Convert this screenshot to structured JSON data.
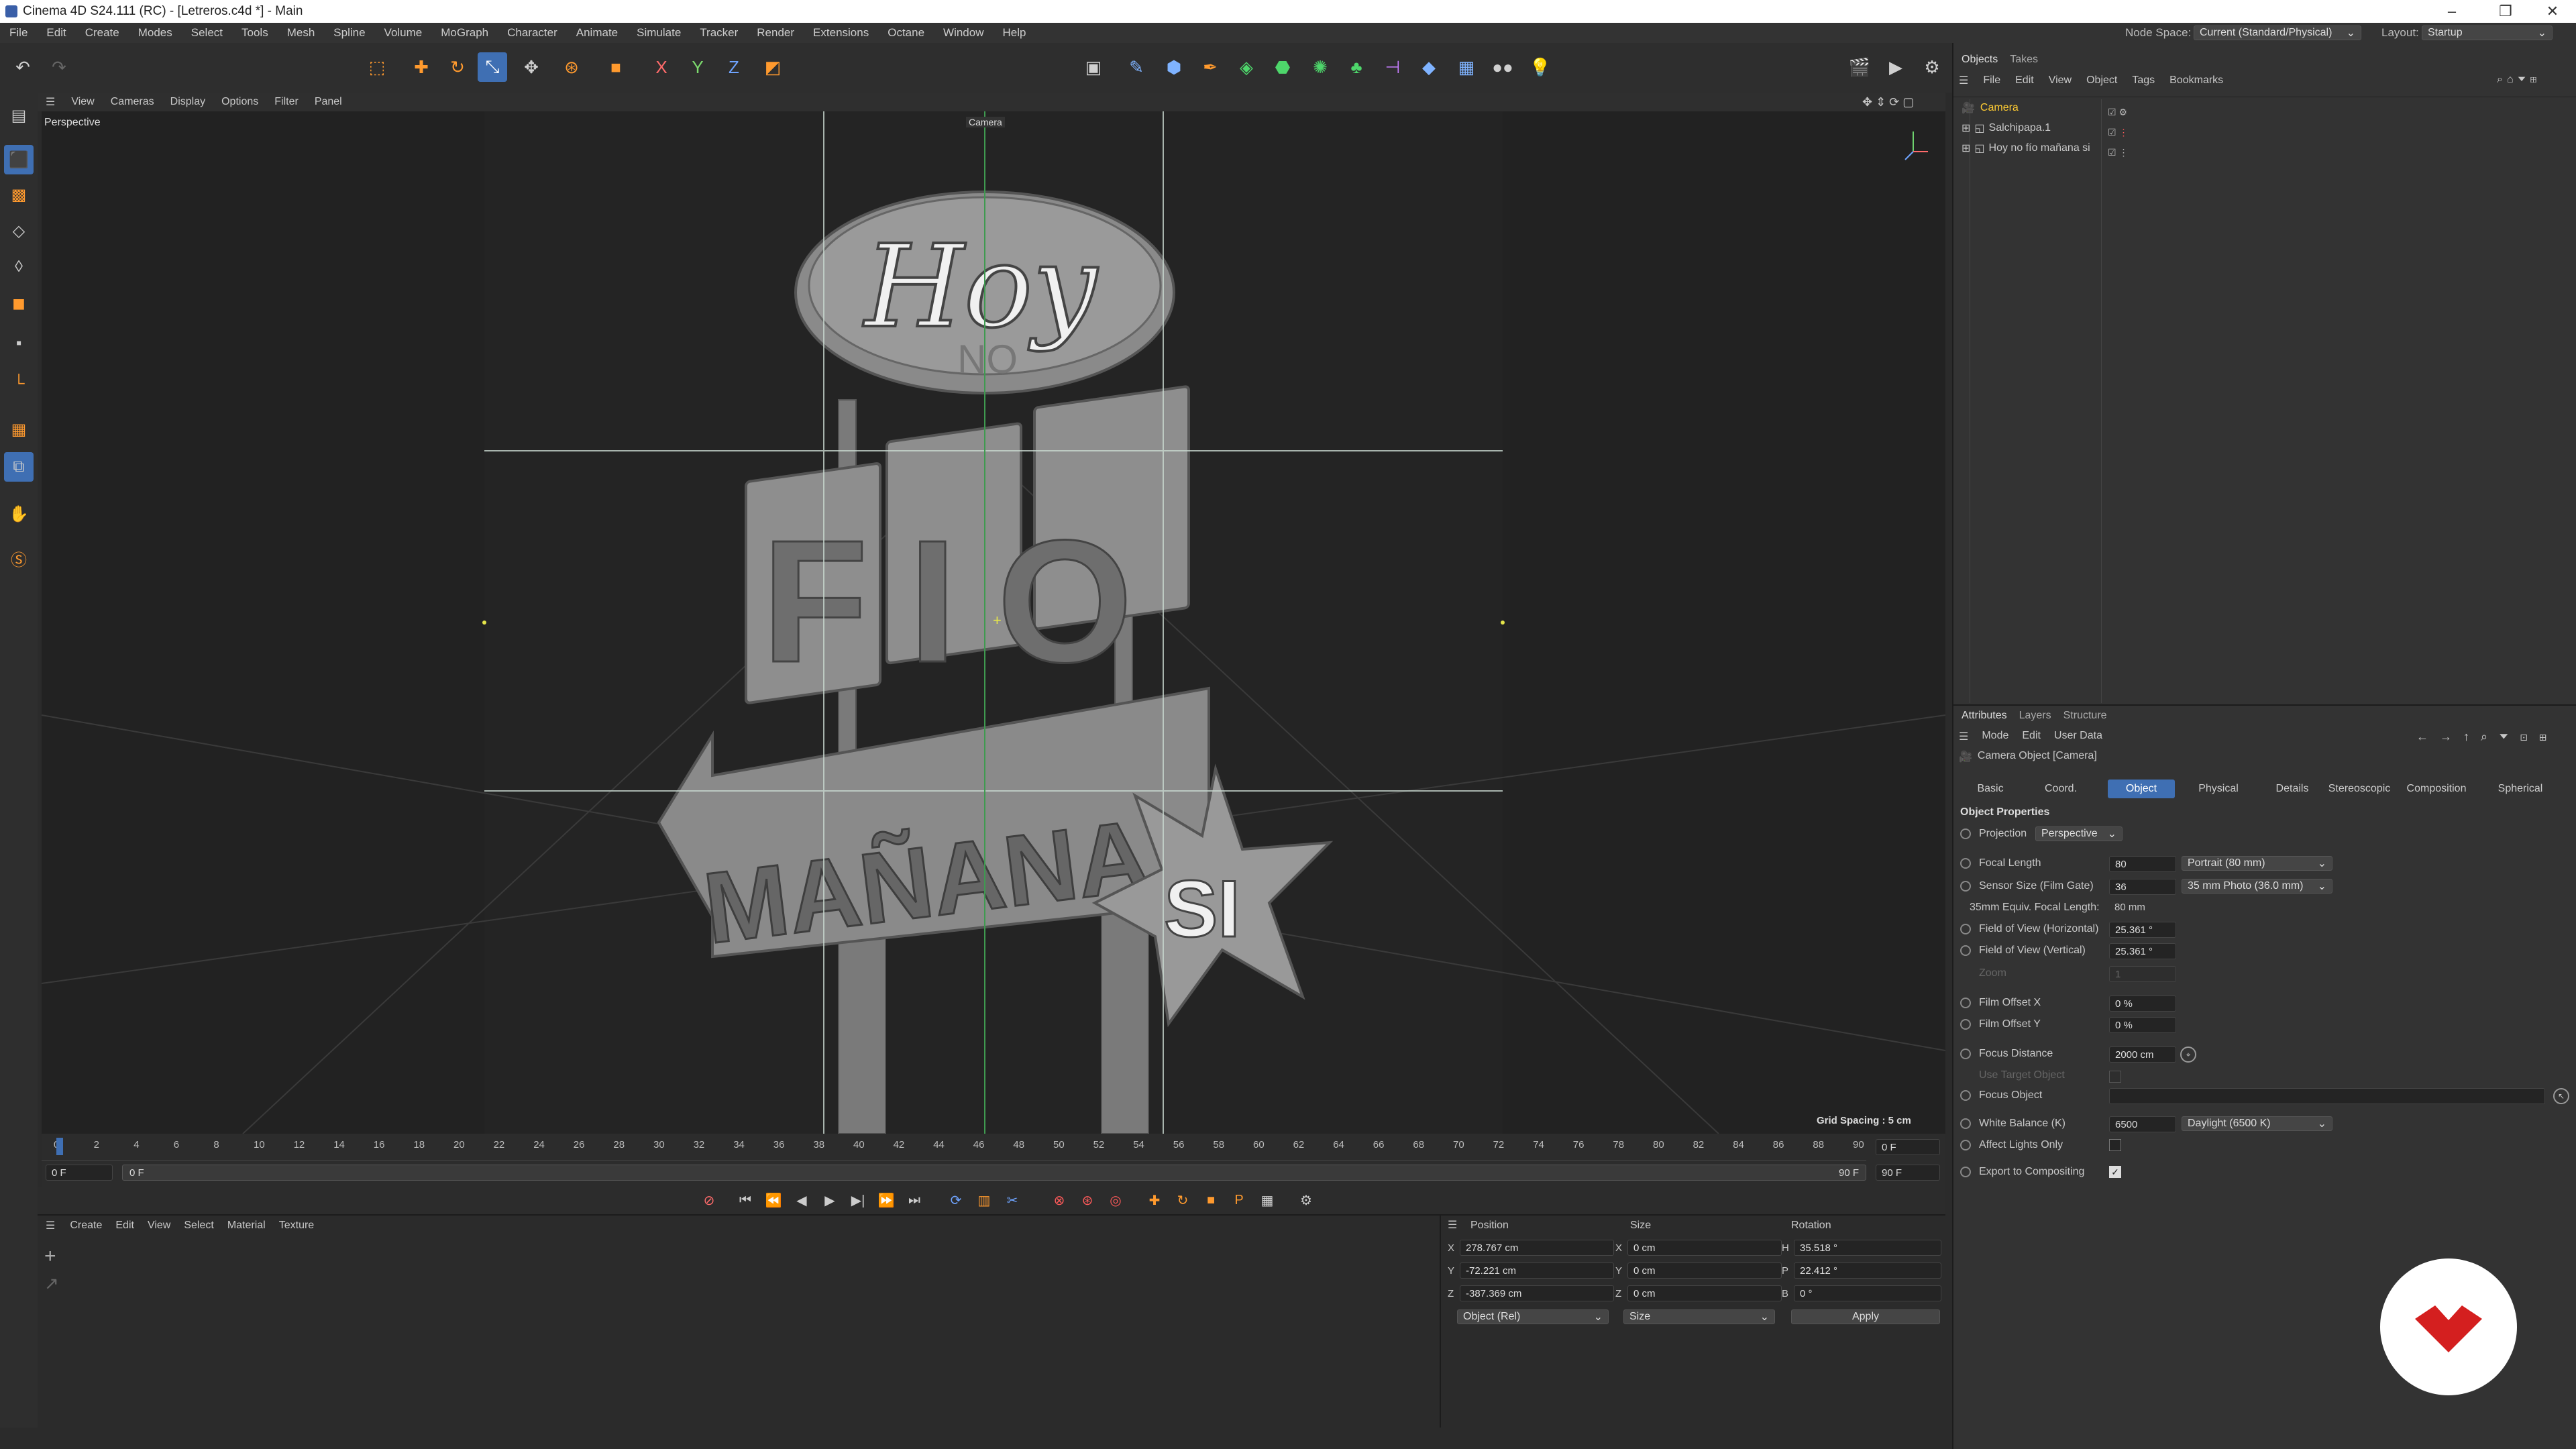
{
  "window": {
    "title": "Cinema 4D S24.111 (RC) - [Letreros.c4d *] - Main"
  },
  "menubar": {
    "items": [
      "File",
      "Edit",
      "Create",
      "Modes",
      "Select",
      "Tools",
      "Mesh",
      "Spline",
      "Volume",
      "MoGraph",
      "Character",
      "Animate",
      "Simulate",
      "Tracker",
      "Render",
      "Extensions",
      "Octane",
      "Window",
      "Help"
    ],
    "node_space_label": "Node Space:",
    "node_space_value": "Current (Standard/Physical)",
    "layout_label": "Layout:",
    "layout_value": "Startup"
  },
  "viewport": {
    "menu": [
      "View",
      "Cameras",
      "Display",
      "Options",
      "Filter",
      "Panel"
    ],
    "name": "Perspective",
    "camera_label": "Camera",
    "grid_spacing": "Grid Spacing : 5 cm",
    "sign": {
      "top": "Hoy",
      "no": "NO",
      "fio": "FIO",
      "arrow": "MAÑANA",
      "star": "SI"
    }
  },
  "timeline": {
    "ticks": [
      "0",
      "2",
      "4",
      "6",
      "8",
      "10",
      "12",
      "14",
      "16",
      "18",
      "20",
      "22",
      "24",
      "26",
      "28",
      "30",
      "32",
      "34",
      "36",
      "38",
      "40",
      "42",
      "44",
      "46",
      "48",
      "50",
      "52",
      "54",
      "56",
      "58",
      "60",
      "62",
      "64",
      "66",
      "68",
      "70",
      "72",
      "74",
      "76",
      "78",
      "80",
      "82",
      "84",
      "86",
      "88",
      "90"
    ],
    "current_frame": "0 F",
    "start": "0 F",
    "range_start": "0 F",
    "range_end": "90 F",
    "end": "90 F"
  },
  "material_manager": {
    "menu": [
      "Create",
      "Edit",
      "View",
      "Select",
      "Material",
      "Texture"
    ]
  },
  "coord_manager": {
    "headers": [
      "Position",
      "Size",
      "Rotation"
    ],
    "rows": [
      {
        "axis": "X",
        "pos": "278.767 cm",
        "size_axis": "X",
        "size": "0 cm",
        "rot_axis": "H",
        "rot": "35.518 °"
      },
      {
        "axis": "Y",
        "pos": "-72.221 cm",
        "size_axis": "Y",
        "size": "0 cm",
        "rot_axis": "P",
        "rot": "22.412 °"
      },
      {
        "axis": "Z",
        "pos": "-387.369 cm",
        "size_axis": "Z",
        "size": "0 cm",
        "rot_axis": "B",
        "rot": "0 °"
      }
    ],
    "mode": "Object (Rel)",
    "size_mode": "Size",
    "apply": "Apply"
  },
  "object_manager": {
    "tabs": [
      "Objects",
      "Takes"
    ],
    "menu": [
      "File",
      "Edit",
      "View",
      "Object",
      "Tags",
      "Bookmarks"
    ],
    "objects": [
      {
        "name": "Camera",
        "color": "#ffcc33"
      },
      {
        "name": "Salchipapa.1",
        "color": "#c8c8c8"
      },
      {
        "name": "Hoy no fío mañana si",
        "color": "#c8c8c8"
      }
    ]
  },
  "attributes": {
    "tabs": [
      "Attributes",
      "Layers",
      "Structure"
    ],
    "menu": [
      "Mode",
      "Edit",
      "User Data"
    ],
    "object_title": "Camera Object [Camera]",
    "subtabs": [
      "Basic",
      "Coord.",
      "Object",
      "Physical",
      "Details",
      "Stereoscopic",
      "Composition",
      "Spherical"
    ],
    "section": "Object Properties",
    "projection_label": "Projection",
    "projection_value": "Perspective",
    "focal_length_label": "Focal Length",
    "focal_length_value": "80",
    "focal_length_preset": "Portrait (80 mm)",
    "sensor_label": "Sensor Size (Film Gate)",
    "sensor_value": "36",
    "sensor_preset": "35 mm Photo (36.0 mm)",
    "equiv_label": "35mm Equiv. Focal Length:",
    "equiv_value": "80 mm",
    "fovh_label": "Field of View (Horizontal)",
    "fovh_value": "25.361 °",
    "fovv_label": "Field of View (Vertical)",
    "fovv_value": "25.361 °",
    "zoom_label": "Zoom",
    "zoom_value": "1",
    "offx_label": "Film Offset X",
    "offx_value": "0 %",
    "offy_label": "Film Offset Y",
    "offy_value": "0 %",
    "focus_dist_label": "Focus Distance",
    "focus_dist_value": "2000 cm",
    "use_target_label": "Use Target Object",
    "focus_obj_label": "Focus Object",
    "wb_label": "White Balance (K)",
    "wb_value": "6500",
    "wb_preset": "Daylight (6500 K)",
    "affect_label": "Affect Lights Only",
    "export_label": "Export to Compositing"
  }
}
